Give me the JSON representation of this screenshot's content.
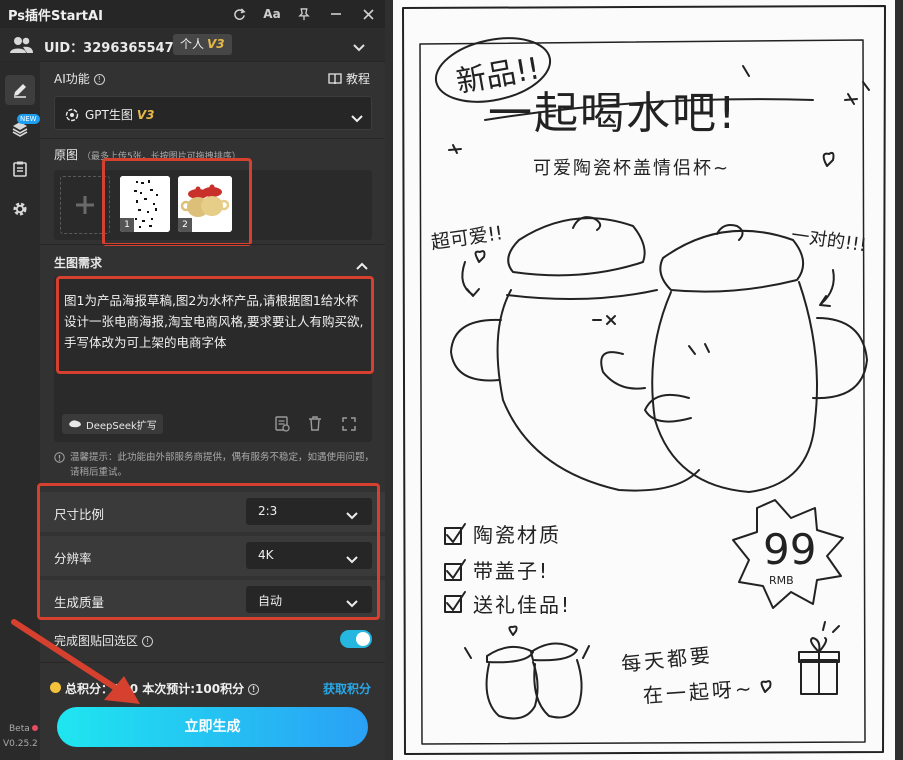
{
  "app": {
    "title": "Ps插件StartAI"
  },
  "titlebar": {
    "font_btn": "Aa"
  },
  "user": {
    "uid_label": "UID：3296365547",
    "plan": "个人",
    "plan_version": "V3"
  },
  "ai_function": {
    "label": "AI功能",
    "tutorial": "教程"
  },
  "model": {
    "name": "GPT生图",
    "version": "V3"
  },
  "source_images": {
    "label": "原图",
    "hint": "（最多上传5张，长按图片可拖拽排序）",
    "thumbnails": [
      {
        "index": "1"
      },
      {
        "index": "2"
      }
    ]
  },
  "requirement": {
    "label": "生图需求",
    "text": "图1为产品海报草稿,图2为水杯产品,请根据图1给水杯设计一张电商海报,淘宝电商风格,要求要让人有购买欲,手写体改为可上架的电商字体",
    "deepseek_btn": "DeepSeek扩写"
  },
  "notice": "温馨提示：此功能由外部服务商提供，偶有服务不稳定，如遇使用问题，请稍后重试。",
  "params": [
    {
      "label": "尺寸比例",
      "value": "2:3"
    },
    {
      "label": "分辨率",
      "value": "4K"
    },
    {
      "label": "生成质量",
      "value": "自动"
    }
  ],
  "paste_back": {
    "label": "完成图贴回选区",
    "enabled": true
  },
  "points": {
    "text": "总积分：930 本次预计:100积分",
    "get_label": "获取积分"
  },
  "generate": {
    "label": "立即生成"
  },
  "footer": {
    "beta": "Beta",
    "version": "V0.25.2"
  },
  "colors": {
    "accent": "#26b7e0",
    "annotation_red": "#d6402e",
    "gold": "#e6b84a",
    "link_blue": "#28a8e8"
  },
  "poster": {
    "badge": "新品!!",
    "headline": "一起喝水吧!",
    "subline": "可爱陶瓷杯盖情侣杯~",
    "note_left": "超可爱!!",
    "note_right": "一对的!!!",
    "features": [
      "陶瓷材质",
      "带盖子!",
      "送礼佳品!"
    ],
    "price": "99",
    "price_unit": "RMB",
    "tagline_1": "每天都要",
    "tagline_2": "在一起呀~"
  }
}
